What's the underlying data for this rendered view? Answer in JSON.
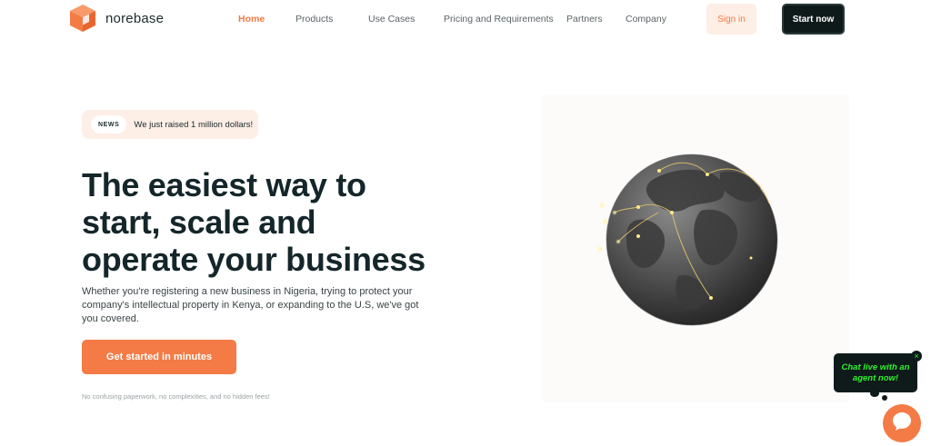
{
  "brand": {
    "name": "norebase",
    "accent": "#f47b45",
    "dark": "#0e1a1a"
  },
  "nav": {
    "items": [
      {
        "label": "Home",
        "active": true
      },
      {
        "label": "Products",
        "active": false
      },
      {
        "label": "Use Cases",
        "active": false
      },
      {
        "label": "Pricing and Requirements",
        "active": false
      },
      {
        "label": "Partners",
        "active": false
      },
      {
        "label": "Company",
        "active": false
      }
    ],
    "signin_label": "Sign in",
    "start_label": "Start now"
  },
  "hero": {
    "news_badge": "NEWS",
    "news_text": "We just raised 1 million dollars!",
    "headline_lines": [
      "The easiest way to",
      "start, scale and",
      "operate your business"
    ],
    "subtext": "Whether you're registering a new business in Nigeria, trying to protect your company's intellectual property in Kenya, or expanding to the U.S, we've got you covered.",
    "cta_label": "Get started in minutes",
    "fineprint": "No confusing paperwork, no complexities, and no hidden fees!"
  },
  "chat": {
    "text": "Chat live with an agent now!",
    "close_symbol": "×",
    "bubble_color": "#0f1a1a",
    "text_color": "#2ef22e"
  },
  "icons": {
    "logo": "cube-logo-icon",
    "globe": "globe-illustration",
    "chat": "chat-bubble-icon"
  }
}
